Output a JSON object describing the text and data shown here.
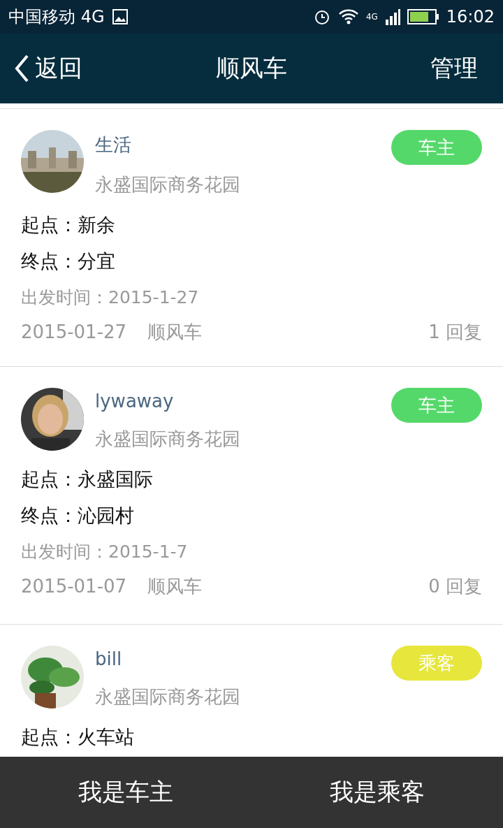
{
  "status_bar": {
    "carrier": "中国移动 4G",
    "network": "4G",
    "time": "16:02"
  },
  "nav": {
    "back": "返回",
    "title": "顺风车",
    "action": "管理"
  },
  "posts": [
    {
      "user": "生活",
      "community": "永盛国际商务花园",
      "role": "车主",
      "color": "#55d86a",
      "origin_label": "起点：",
      "origin": "新余",
      "dest_label": "终点：",
      "dest": "分宜",
      "depart": "出发时间：2015-1-27",
      "date": "2015-01-27",
      "category": "顺风车",
      "replies": "1 回复"
    },
    {
      "user": "lywaway",
      "community": "永盛国际商务花园",
      "role": "车主",
      "color": "#55d86a",
      "origin_label": "起点：",
      "origin": "永盛国际",
      "dest_label": "终点：",
      "dest": "沁园村",
      "depart": "出发时间：2015-1-7",
      "date": "2015-01-07",
      "category": "顺风车",
      "replies": "0 回复"
    },
    {
      "user": "bill",
      "community": "永盛国际商务花园",
      "role": "乘客",
      "color": "#e6e63c",
      "origin_label": "起点：",
      "origin": "火车站"
    }
  ],
  "bottom_tabs": [
    {
      "label": "我是车主"
    },
    {
      "label": "我是乘客"
    }
  ]
}
